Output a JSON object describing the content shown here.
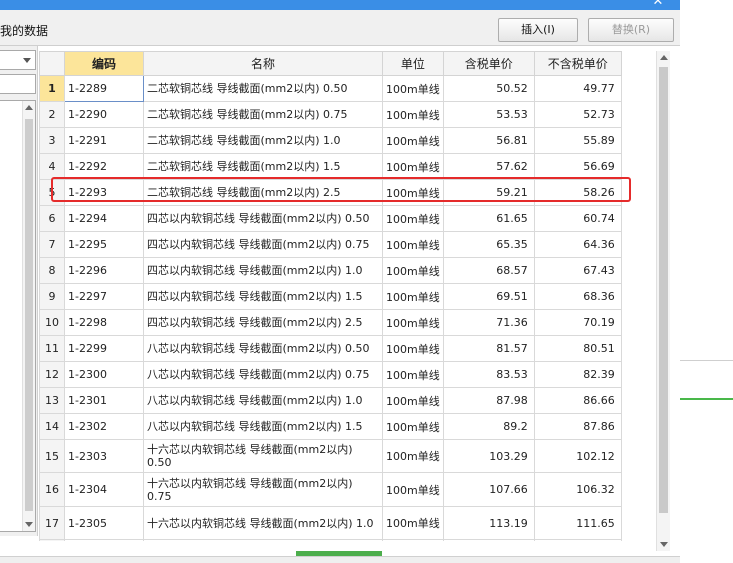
{
  "toolbar": {
    "title": "我的数据",
    "insert_label": "插入(I)",
    "replace_label": "替换(R)",
    "close_glyph": "✕"
  },
  "table": {
    "headers": [
      "编码",
      "名称",
      "单位",
      "含税单价",
      "不含税单价"
    ],
    "rows": [
      {
        "no": "1",
        "code": "1-2289",
        "name": "二芯软铜芯线 导线截面(mm2以内) 0.50",
        "unit": "100m单线",
        "tax_price": "50.52",
        "notax_price": "49.77"
      },
      {
        "no": "2",
        "code": "1-2290",
        "name": "二芯软铜芯线 导线截面(mm2以内) 0.75",
        "unit": "100m单线",
        "tax_price": "53.53",
        "notax_price": "52.73"
      },
      {
        "no": "3",
        "code": "1-2291",
        "name": "二芯软铜芯线 导线截面(mm2以内) 1.0",
        "unit": "100m单线",
        "tax_price": "56.81",
        "notax_price": "55.89"
      },
      {
        "no": "4",
        "code": "1-2292",
        "name": "二芯软铜芯线 导线截面(mm2以内) 1.5",
        "unit": "100m单线",
        "tax_price": "57.62",
        "notax_price": "56.69"
      },
      {
        "no": "5",
        "code": "1-2293",
        "name": "二芯软铜芯线 导线截面(mm2以内) 2.5",
        "unit": "100m单线",
        "tax_price": "59.21",
        "notax_price": "58.26"
      },
      {
        "no": "6",
        "code": "1-2294",
        "name": "四芯以内软铜芯线 导线截面(mm2以内) 0.50",
        "unit": "100m单线",
        "tax_price": "61.65",
        "notax_price": "60.74"
      },
      {
        "no": "7",
        "code": "1-2295",
        "name": "四芯以内软铜芯线 导线截面(mm2以内) 0.75",
        "unit": "100m单线",
        "tax_price": "65.35",
        "notax_price": "64.36"
      },
      {
        "no": "8",
        "code": "1-2296",
        "name": "四芯以内软铜芯线 导线截面(mm2以内) 1.0",
        "unit": "100m单线",
        "tax_price": "68.57",
        "notax_price": "67.43"
      },
      {
        "no": "9",
        "code": "1-2297",
        "name": "四芯以内软铜芯线 导线截面(mm2以内) 1.5",
        "unit": "100m单线",
        "tax_price": "69.51",
        "notax_price": "68.36"
      },
      {
        "no": "10",
        "code": "1-2298",
        "name": "四芯以内软铜芯线 导线截面(mm2以内) 2.5",
        "unit": "100m单线",
        "tax_price": "71.36",
        "notax_price": "70.19"
      },
      {
        "no": "11",
        "code": "1-2299",
        "name": "八芯以内软铜芯线 导线截面(mm2以内) 0.50",
        "unit": "100m单线",
        "tax_price": "81.57",
        "notax_price": "80.51"
      },
      {
        "no": "12",
        "code": "1-2300",
        "name": "八芯以内软铜芯线 导线截面(mm2以内) 0.75",
        "unit": "100m单线",
        "tax_price": "83.53",
        "notax_price": "82.39"
      },
      {
        "no": "13",
        "code": "1-2301",
        "name": "八芯以内软铜芯线 导线截面(mm2以内) 1.0",
        "unit": "100m单线",
        "tax_price": "87.98",
        "notax_price": "86.66"
      },
      {
        "no": "14",
        "code": "1-2302",
        "name": "八芯以内软铜芯线 导线截面(mm2以内) 1.5",
        "unit": "100m单线",
        "tax_price": "89.2",
        "notax_price": "87.86"
      },
      {
        "no": "15",
        "code": "1-2303",
        "name": "十六芯以内软铜芯线 导线截面(mm2以内) 0.50",
        "unit": "100m单线",
        "tax_price": "103.29",
        "notax_price": "102.12"
      },
      {
        "no": "16",
        "code": "1-2304",
        "name": "十六芯以内软铜芯线 导线截面(mm2以内) 0.75",
        "unit": "100m单线",
        "tax_price": "107.66",
        "notax_price": "106.32"
      },
      {
        "no": "17",
        "code": "1-2305",
        "name": "十六芯以内软铜芯线 导线截面(mm2以内) 1.0",
        "unit": "100m单线",
        "tax_price": "113.19",
        "notax_price": "111.65"
      },
      {
        "no": "",
        "code": "",
        "name": "十六芯以内软铜芯线 导线截面(mm2以内)",
        "unit": "",
        "tax_price": "",
        "notax_price": ""
      }
    ]
  },
  "colors": {
    "title_bar": "#3a8ee6",
    "header_sorted": "#fce59a",
    "highlight_border": "#e52b2b",
    "scroll_indicator": "#4cae4c"
  }
}
